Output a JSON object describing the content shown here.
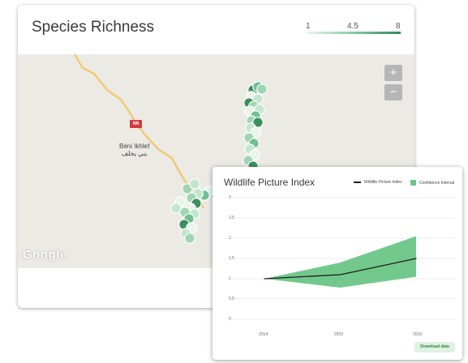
{
  "species_card": {
    "title": "Species Richness",
    "scale": {
      "min": "1",
      "mid": "4.5",
      "max": "8"
    }
  },
  "map": {
    "road_label": "N6",
    "town_latin": "Béni Ikhlef",
    "town_arabic": "بني يخلف",
    "zoom_in": "+",
    "zoom_out": "−",
    "logo": "Google",
    "marker_colors": [
      "#e7f4ea",
      "#c4e6cf",
      "#9fd6b1",
      "#73bf8f",
      "#3d8f5e"
    ]
  },
  "wpi_card": {
    "title": "Wildlife Picture Index",
    "legend": {
      "index_label": "Wildlife Picture Index",
      "ci_label": "Confidence Interval"
    },
    "download_label": "Download data"
  },
  "chart_data": {
    "type": "line",
    "title": "Wildlife Picture Index",
    "x": [
      "2014",
      "2015",
      "2016"
    ],
    "y_ticks": [
      "0",
      "0.5",
      "1",
      "1.5",
      "2",
      "2.5",
      "3"
    ],
    "ylim": [
      0,
      3
    ],
    "series": [
      {
        "name": "Wildlife Picture Index",
        "values": [
          1,
          1.1,
          1.5
        ]
      }
    ],
    "confidence_interval": {
      "name": "Confidence Interval",
      "lower": [
        1,
        0.78,
        1.05
      ],
      "upper": [
        1,
        1.4,
        2.05
      ]
    },
    "colors": {
      "line": "#1d1d1d",
      "band": "#6cc686"
    },
    "grid": true,
    "legend": "top-right"
  }
}
